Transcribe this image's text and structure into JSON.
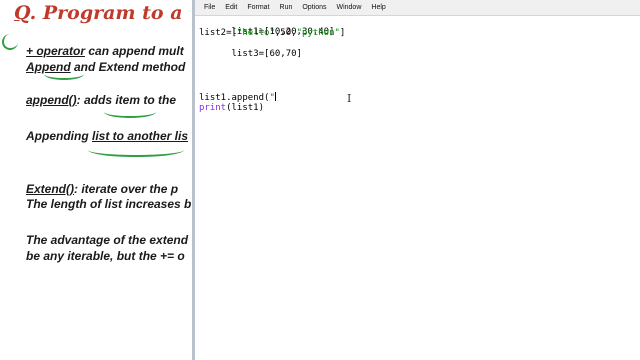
{
  "slide": {
    "title_q": "Q",
    "title_rest": "Program to a",
    "lines": [
      {
        "pre": "",
        "u": "+ operator",
        "post": " can append mult"
      },
      {
        "pre": "",
        "u": "Append",
        "post": " and Extend method"
      },
      {
        "pre": "",
        "u": "append()",
        "post": ": adds item to the"
      },
      {
        "pre": "Appending ",
        "u": "list to another lis",
        "post": ""
      },
      {
        "pre": "",
        "u": "Extend()",
        "post": ":  iterate over the p"
      },
      {
        "pre": "The length of list increases b",
        "u": "",
        "post": ""
      },
      {
        "pre": "The advantage of the extend",
        "u": "",
        "post": ""
      },
      {
        "pre": "be any iterable, but the += o",
        "u": "",
        "post": ""
      }
    ]
  },
  "menu": [
    "File",
    "Edit",
    "Format",
    "Run",
    "Options",
    "Window",
    "Help"
  ],
  "code": {
    "line1": "list1=[10,20,30,40]",
    "line2_a": "list2=[",
    "line2_s1": "\"hello\"",
    "line2_b": ",50,",
    "line2_s2": "\"python\"",
    "line2_c": "]",
    "line3": "list3=[60,70]",
    "line4_a": "list1.append(",
    "line4_s": "\"",
    "line5_kw": "print",
    "line5_rest": "(list1)"
  }
}
